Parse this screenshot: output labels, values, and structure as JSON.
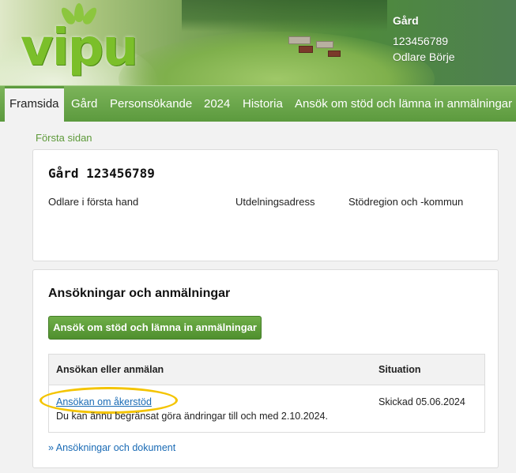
{
  "header": {
    "logo_text": "vipu",
    "farm_title": "Gård",
    "farm_id": "123456789",
    "farmer_name": "Odlare Börje"
  },
  "nav": {
    "items": [
      "Framsida",
      "Gård",
      "Personsökande",
      "2024",
      "Historia",
      "Ansök om stöd och lämna in anmälningar"
    ],
    "active": "Framsida"
  },
  "breadcrumb": "Första sidan",
  "farm_panel": {
    "title": "Gård  123456789",
    "labels": [
      "Odlare i första hand",
      "Utdelningsadress",
      "Stödregion och -kommun"
    ]
  },
  "applications_panel": {
    "title": "Ansökningar och anmälningar",
    "button_label": "Ansök om stöd och lämna in anmälningar",
    "table": {
      "columns": [
        "Ansökan eller anmälan",
        "Situation"
      ],
      "rows": [
        {
          "name": "Ansökan om åkerstöd",
          "note": "Du kan ännu begränsat göra ändringar till och med 2.10.2024.",
          "status": "Skickad 05.06.2024"
        }
      ]
    },
    "documents_link": "» Ansökningar och dokument"
  },
  "colors": {
    "brand_green": "#5c9a3e",
    "link_blue": "#1a6bb5",
    "highlight": "#f4c400"
  }
}
